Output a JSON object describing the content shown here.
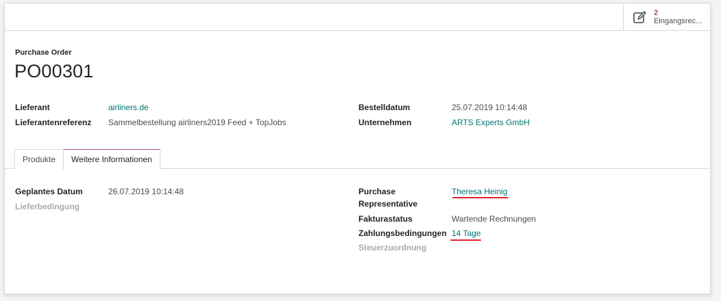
{
  "smart_button": {
    "count": "2",
    "label": "Eingangsrec..."
  },
  "header": {
    "doc_type": "Purchase Order",
    "name": "PO00301"
  },
  "main": {
    "left": [
      {
        "label": "Lieferant",
        "value": "airliners.de"
      },
      {
        "label": "Lieferantenreferenz",
        "value": "Sammelbestellung airliners2019 Feed + TopJobs"
      }
    ],
    "right": [
      {
        "label": "Bestelldatum",
        "value": "25.07.2019 10:14:48"
      },
      {
        "label": "Unternehmen",
        "value": "ARTS Experts GmbH"
      }
    ]
  },
  "tabs": [
    {
      "label": "Produkte"
    },
    {
      "label": "Weitere Informationen"
    }
  ],
  "info": {
    "left": [
      {
        "label": "Geplantes Datum",
        "value": "26.07.2019 10:14:48"
      },
      {
        "label": "Lieferbedingung",
        "value": ""
      }
    ],
    "right": [
      {
        "label_line1": "Purchase",
        "label_line2": "Representative",
        "value": "Theresa Heinig"
      },
      {
        "label": "Fakturastatus",
        "value": "Wartende Rechnungen"
      },
      {
        "label": "Zahlungsbedingungen",
        "value": "14 Tage"
      },
      {
        "label": "Steuerzuordnung",
        "value": ""
      }
    ]
  },
  "colors": {
    "link": "#00736f",
    "accent": "#a24689",
    "highlight": "#e6232a"
  },
  "icons": {
    "smart_button": "pencil-square-icon"
  }
}
